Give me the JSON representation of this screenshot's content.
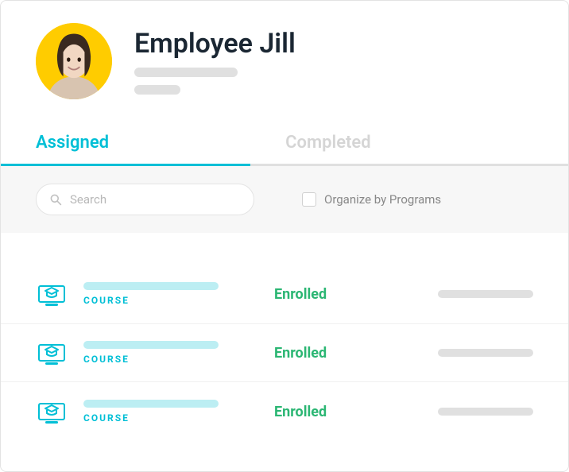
{
  "header": {
    "name": "Employee Jill"
  },
  "tabs": {
    "assigned": "Assigned",
    "completed": "Completed"
  },
  "search": {
    "placeholder": "Search",
    "organize_label": "Organize by Programs"
  },
  "course_label": "COURSE",
  "rows": [
    {
      "status": "Enrolled"
    },
    {
      "status": "Enrolled"
    },
    {
      "status": "Enrolled"
    }
  ]
}
